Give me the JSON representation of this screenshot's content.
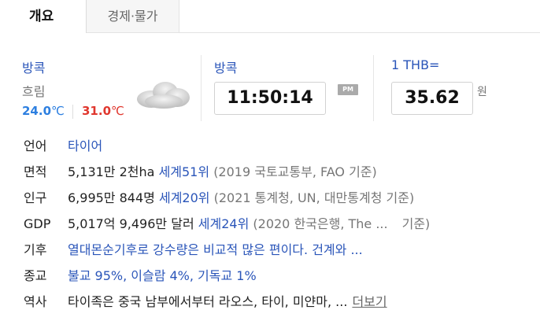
{
  "tabs": [
    {
      "label": "개요",
      "active": true
    },
    {
      "label": "경제·물가",
      "active": false
    }
  ],
  "weather": {
    "city": "방콕",
    "condition": "흐림",
    "condition_icon": "cloud-icon",
    "temp_low": "24.0",
    "temp_high": "31.0",
    "temp_unit": "℃",
    "low_color": "#2d7fe0",
    "high_color": "#e0372e"
  },
  "clock": {
    "city": "방콕",
    "time": "11:50:14",
    "ampm": "PM"
  },
  "exchange": {
    "label": "1 THB=",
    "value": "35.62",
    "unit": "원"
  },
  "info": {
    "language": {
      "label": "언어",
      "value": "타이어"
    },
    "area": {
      "label": "면적",
      "value": "5,131만 2천ha",
      "rank": "세계51위",
      "source": "(2019 국토교통부, FAO 기준)"
    },
    "population": {
      "label": "인구",
      "value": "6,995만 844명",
      "rank": "세계20위",
      "source": "(2021 통계청, UN, 대만통계청 기준)"
    },
    "gdp": {
      "label": "GDP",
      "value": "5,017억 9,496만 달러",
      "rank": "세계24위",
      "source": "(2020 한국은행, The ...",
      "source_end": "기준)"
    },
    "climate": {
      "label": "기후",
      "value": "열대몬순기후로 강수량은 비교적 많은 편이다. 건계와 ..."
    },
    "religion": {
      "label": "종교",
      "value": "불교 95%, 이슬람 4%, 기독교 1%"
    },
    "history": {
      "label": "역사",
      "value": "타이족은 중국 남부에서부터 라오스, 타이, 미얀마, ...",
      "more": "더보기"
    }
  },
  "accent_color": "#2a55b9"
}
